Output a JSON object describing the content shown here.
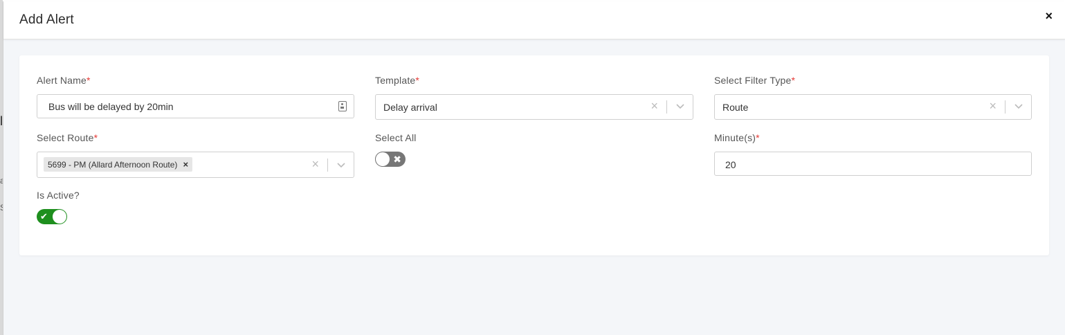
{
  "backdrop": {
    "marks": [
      "l",
      "a",
      "S"
    ]
  },
  "modal": {
    "title": "Add Alert",
    "close_glyph": "×"
  },
  "form": {
    "required_mark": "*",
    "alert_name": {
      "label": "Alert Name",
      "value": "Bus will be delayed by 20min",
      "icon": "contact-card-icon"
    },
    "template": {
      "label": "Template",
      "value": "Delay arrival"
    },
    "filter_type": {
      "label": "Select Filter Type",
      "value": "Route"
    },
    "route": {
      "label": "Select Route",
      "chip": "5699 - PM (Allard Afternoon Route)",
      "chip_remove": "×"
    },
    "select_all": {
      "label": "Select All",
      "on": false,
      "glyph": "✖"
    },
    "minutes": {
      "label": "Minute(s)",
      "value": "20"
    },
    "is_active": {
      "label": "Is Active?",
      "on": true,
      "glyph": "✔"
    },
    "clear_glyph": "×"
  },
  "colors": {
    "accent_on": "#1e8f1e",
    "toggle_off": "#777777",
    "required": "#e53935"
  }
}
